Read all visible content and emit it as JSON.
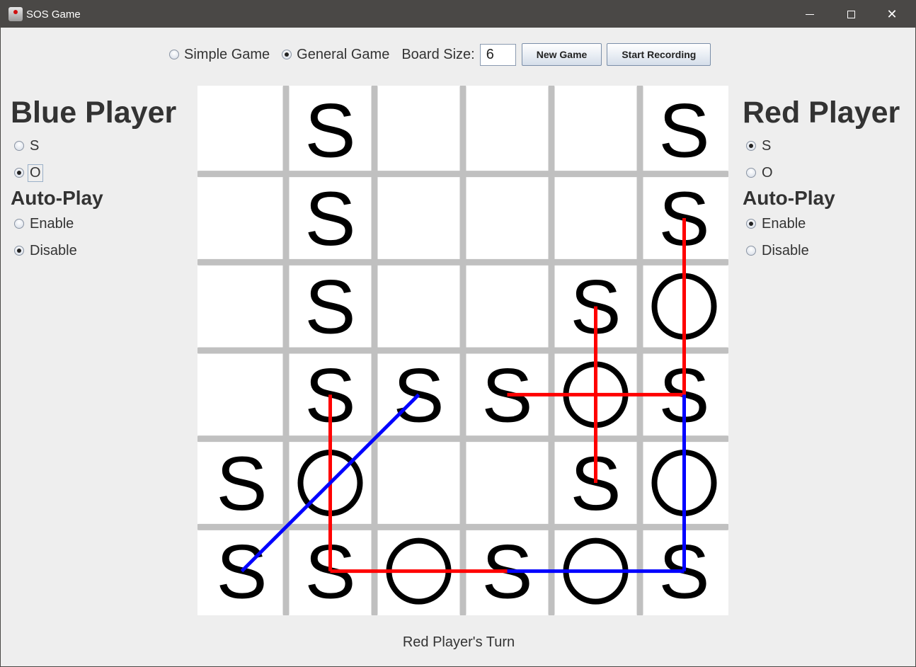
{
  "window": {
    "title": "SOS Game",
    "controls": [
      "minimize",
      "maximize",
      "close"
    ]
  },
  "topbar": {
    "mode_options": [
      {
        "label": "Simple Game",
        "checked": false
      },
      {
        "label": "General Game",
        "checked": true
      }
    ],
    "board_size_label": "Board Size:",
    "board_size_value": "6",
    "new_game_label": "New Game",
    "start_recording_label": "Start Recording"
  },
  "blue_player": {
    "title": "Blue Player",
    "letter_options": [
      {
        "label": "S",
        "checked": false
      },
      {
        "label": "O",
        "checked": true
      }
    ],
    "autoplay_title": "Auto-Play",
    "autoplay_options": [
      {
        "label": "Enable",
        "checked": false
      },
      {
        "label": "Disable",
        "checked": true
      }
    ]
  },
  "red_player": {
    "title": "Red Player",
    "letter_options": [
      {
        "label": "S",
        "checked": true
      },
      {
        "label": "O",
        "checked": false
      }
    ],
    "autoplay_title": "Auto-Play",
    "autoplay_options": [
      {
        "label": "Enable",
        "checked": true
      },
      {
        "label": "Disable",
        "checked": false
      }
    ]
  },
  "board": {
    "size": 6,
    "cells": [
      [
        "",
        "S",
        "",
        "",
        "",
        "S"
      ],
      [
        "",
        "S",
        "",
        "",
        "",
        "S"
      ],
      [
        "",
        "S",
        "",
        "",
        "S",
        "O"
      ],
      [
        "",
        "S",
        "S",
        "S",
        "O",
        "S"
      ],
      [
        "S",
        "O",
        "",
        "",
        "S",
        "O"
      ],
      [
        "S",
        "S",
        "O",
        "S",
        "O",
        "S"
      ]
    ],
    "sos_lines": [
      {
        "player": "red",
        "from": [
          5,
          1
        ],
        "to": [
          5,
          3
        ]
      },
      {
        "player": "red",
        "from": [
          4,
          2
        ],
        "to": [
          4,
          4
        ]
      },
      {
        "player": "red",
        "from": [
          3,
          3
        ],
        "to": [
          5,
          3
        ]
      },
      {
        "player": "red",
        "from": [
          1,
          3
        ],
        "to": [
          1,
          5
        ]
      },
      {
        "player": "red",
        "from": [
          1,
          5
        ],
        "to": [
          3,
          5
        ]
      },
      {
        "player": "blue",
        "from": [
          0,
          5
        ],
        "to": [
          2,
          3
        ]
      },
      {
        "player": "blue",
        "from": [
          5,
          3
        ],
        "to": [
          5,
          5
        ]
      },
      {
        "player": "blue",
        "from": [
          3,
          5
        ],
        "to": [
          5,
          5
        ]
      }
    ],
    "colors": {
      "red": "#ff0000",
      "blue": "#0000ff",
      "grid": "#c0c0c0",
      "letter": "#000000"
    }
  },
  "status": "Red Player's Turn"
}
